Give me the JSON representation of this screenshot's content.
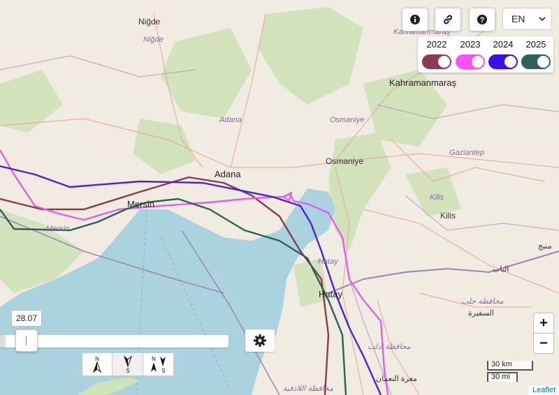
{
  "map": {
    "cities": {
      "nigde": "Niğde",
      "nigde_prov": "Niğde",
      "kahramanmaras_prov": "Kahramanmaraş",
      "kahramanmaras": "Kahramanmaraş",
      "adana_prov": "Adana",
      "osmaniye_prov": "Osmaniye",
      "gaziantep_prov": "Gaziantep",
      "adana": "Adana",
      "osmaniye": "Osmaniye",
      "mersin": "Mersin",
      "mersin_prov": "Mersin",
      "kilis_prov": "Kilis",
      "kilis": "Kilis",
      "hatay_prov": "Hatay",
      "hatay": "Hatay",
      "manbij": "منبج",
      "albab": "الباب",
      "aleppo_gov": "محافظة حلب",
      "safira": "السفيرة",
      "idlib_gov": "محافظة ادلب",
      "maarat": "معرة النعمان",
      "latakia_gov": "محافظة اللاذقية"
    },
    "tracks": [
      {
        "year": "2022",
        "color": "#8b3a4f"
      },
      {
        "year": "2023",
        "color": "#e85ce8"
      },
      {
        "year": "2024",
        "color": "#4b22e0"
      },
      {
        "year": "2025",
        "color": "#2f5f5a"
      }
    ]
  },
  "toolbar": {
    "info_icon": "info-icon",
    "link_icon": "link-icon",
    "help_icon": "question-icon",
    "language": "EN"
  },
  "years": {
    "items": [
      {
        "label": "2022",
        "color": "#8b3a4f",
        "on": true
      },
      {
        "label": "2023",
        "color": "#ff50f0",
        "on": true
      },
      {
        "label": "2024",
        "color": "#3b10e8",
        "on": true
      },
      {
        "label": "2025",
        "color": "#2f5f5a",
        "on": true
      }
    ]
  },
  "timeline": {
    "value": "28.07"
  },
  "north": {
    "n": "N",
    "s": "S"
  },
  "zoom": {
    "in": "+",
    "out": "−"
  },
  "scale": {
    "km": "30 km",
    "mi": "30 mi"
  },
  "attribution": "Leaflet"
}
